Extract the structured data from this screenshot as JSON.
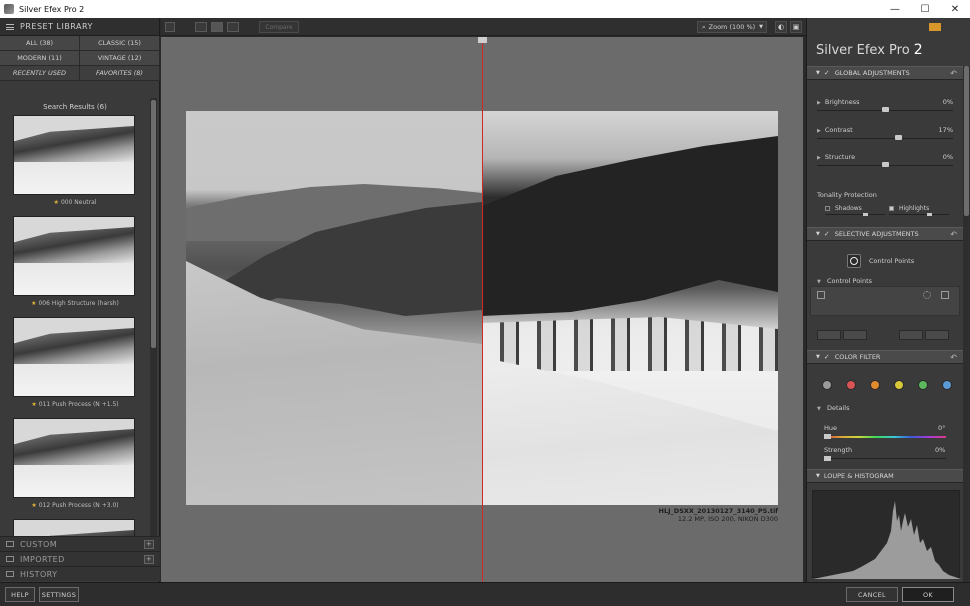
{
  "window": {
    "title": "Silver Efex Pro 2",
    "controls": [
      "—",
      "☐",
      "✕"
    ]
  },
  "left_panel": {
    "header": "PRESET LIBRARY",
    "categories": [
      {
        "label": "ALL (38)"
      },
      {
        "label": "CLASSIC (15)"
      },
      {
        "label": "MODERN (11)"
      },
      {
        "label": "VINTAGE (12)"
      },
      {
        "label": "RECENTLY USED"
      },
      {
        "label": "FAVORITES (8)"
      }
    ],
    "results_title": "Search Results (6)",
    "presets": [
      {
        "label": "000 Neutral"
      },
      {
        "label": "006 High Structure (harsh)"
      },
      {
        "label": "011 Push Process (N +1.5)"
      },
      {
        "label": "012 Push Process (N +3.0)"
      },
      {
        "label": ""
      }
    ],
    "sections": [
      {
        "label": "CUSTOM"
      },
      {
        "label": "IMPORTED"
      },
      {
        "label": "HISTORY"
      }
    ],
    "plus_glyph": "+"
  },
  "toolbar": {
    "compare_label": "Compare",
    "zoom_label": "Zoom (100 %)"
  },
  "canvas": {
    "filename": "HLJ_DSXX_20130127_3140_PS.tif",
    "meta": "12.2 MP, ISO 200, NIKON D300"
  },
  "right_panel": {
    "product": "Silver Efex Pro",
    "version": "2",
    "global_header": "GLOBAL ADJUSTMENTS",
    "sliders": [
      {
        "label": "Brightness",
        "value": "0%",
        "position": 0.5
      },
      {
        "label": "Contrast",
        "value": "17%",
        "position": 0.6
      },
      {
        "label": "Structure",
        "value": "0%",
        "position": 0.5
      }
    ],
    "tonality_label": "Tonality Protection",
    "shadows_label": "Shadows",
    "highlights_label": "Highlights",
    "selective_header": "SELECTIVE ADJUSTMENTS",
    "control_points_button": "Control Points",
    "control_points_list_label": "Control Points",
    "color_filter_header": "COLOR FILTER",
    "filter_colors": [
      "#9a9a9a",
      "#d95454",
      "#e08a2e",
      "#d7c93a",
      "#5cb85c",
      "#5b9bd5"
    ],
    "details_label": "Details",
    "hue_label": "Hue",
    "hue_value": "0°",
    "strength_label": "Strength",
    "strength_value": "0%",
    "loupe_header": "LOUPE & HISTOGRAM",
    "check_glyph": "✓",
    "reset_glyph": "↶"
  },
  "bottom_bar": {
    "help": "HELP",
    "settings": "SETTINGS",
    "cancel": "CANCEL",
    "ok": "OK"
  }
}
